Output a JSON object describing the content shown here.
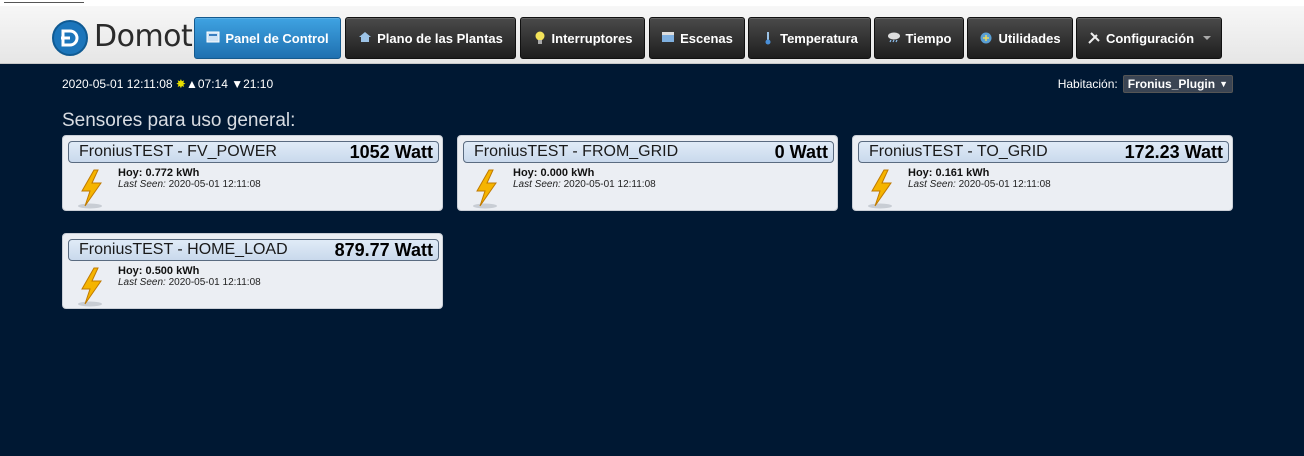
{
  "logo": {
    "text": "Domoticz"
  },
  "nav": [
    {
      "label": "Panel de Control",
      "icon": "dashboard-icon",
      "active": true
    },
    {
      "label": "Plano de las Plantas",
      "icon": "house-icon"
    },
    {
      "label": "Interruptores",
      "icon": "lightbulb-icon"
    },
    {
      "label": "Escenas",
      "icon": "clapperboard-icon"
    },
    {
      "label": "Temperatura",
      "icon": "thermometer-icon"
    },
    {
      "label": "Tiempo",
      "icon": "weather-icon"
    },
    {
      "label": "Utilidades",
      "icon": "utilities-icon"
    },
    {
      "label": "Configuración",
      "icon": "tools-icon"
    }
  ],
  "info": {
    "datetime": "2020-05-01 12:11:08",
    "sunrise": "07:14",
    "sunset": "21:10"
  },
  "room": {
    "label": "Habitación:",
    "selected": "Fronius_Plugin"
  },
  "section_title": "Sensores para uso general:",
  "devices": [
    {
      "name": "FroniusTEST - FV_POWER",
      "value": "1052 Watt",
      "today_label": "Hoy:",
      "today": "0.772 kWh",
      "seen_label": "Last Seen:",
      "seen": "2020-05-01 12:11:08"
    },
    {
      "name": "FroniusTEST - FROM_GRID",
      "value": "0 Watt",
      "today_label": "Hoy:",
      "today": "0.000 kWh",
      "seen_label": "Last Seen:",
      "seen": "2020-05-01 12:11:08"
    },
    {
      "name": "FroniusTEST - TO_GRID",
      "value": "172.23 Watt",
      "today_label": "Hoy:",
      "today": "0.161 kWh",
      "seen_label": "Last Seen:",
      "seen": "2020-05-01 12:11:08"
    },
    {
      "name": "FroniusTEST - HOME_LOAD",
      "value": "879.77 Watt",
      "today_label": "Hoy:",
      "today": "0.500 kWh",
      "seen_label": "Last Seen:",
      "seen": "2020-05-01 12:11:08"
    }
  ],
  "colors": {
    "background": "#001833",
    "accent": "#1f70b0",
    "bolt": "#f5b400"
  }
}
